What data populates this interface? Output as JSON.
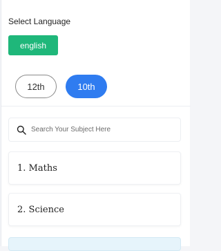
{
  "language": {
    "label": "Select Language",
    "selected": "english",
    "accent": "#1fb77a"
  },
  "classes": {
    "options": [
      "12th",
      "10th"
    ],
    "active": "10th",
    "active_color": "#2f7cf0"
  },
  "search": {
    "placeholder": "Search Your Subject Here",
    "icon": "search-icon"
  },
  "subjects": [
    {
      "label": "1. Maths"
    },
    {
      "label": "2. Science"
    }
  ]
}
